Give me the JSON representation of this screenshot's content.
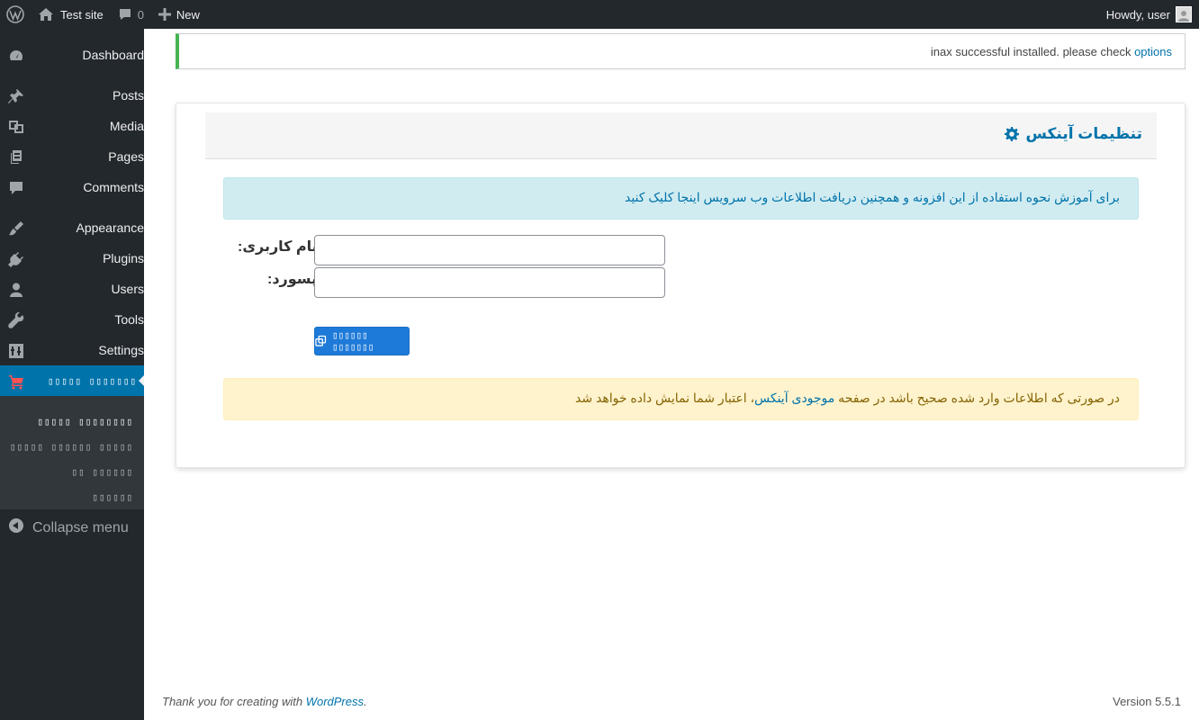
{
  "adminbar": {
    "site_name": "Test site",
    "comments_count": "0",
    "new_label": "New",
    "howdy": "Howdy, user"
  },
  "sidebar": {
    "items": [
      {
        "label": "Dashboard",
        "icon": "dashboard-icon"
      },
      {
        "label": "Posts",
        "icon": "pin-icon"
      },
      {
        "label": "Media",
        "icon": "media-icon"
      },
      {
        "label": "Pages",
        "icon": "pages-icon"
      },
      {
        "label": "Comments",
        "icon": "comment-icon"
      },
      {
        "label": "Appearance",
        "icon": "brush-icon"
      },
      {
        "label": "Plugins",
        "icon": "plug-icon"
      },
      {
        "label": "Users",
        "icon": "user-icon"
      },
      {
        "label": "Tools",
        "icon": "wrench-icon"
      },
      {
        "label": "Settings",
        "icon": "settings-icon"
      },
      {
        "label": "▯▯▯▯▯ ▯▯▯▯▯▯▯",
        "icon": "cart-icon"
      }
    ],
    "submenu": [
      "▯▯▯▯▯ ▯▯▯▯▯▯▯▯",
      "▯▯▯▯▯ ▯▯▯▯▯▯ ▯▯▯▯▯",
      "▯▯ ▯▯▯▯▯▯",
      "▯▯▯▯▯▯"
    ],
    "collapse_label": "Collapse menu"
  },
  "notice": {
    "text": "inax successful installed. please check ",
    "link": "options"
  },
  "card": {
    "title": "تنظیمات آینکس",
    "info_text": "برای آموزش نحوه استفاده از این افزونه و همچنین دریافت اطلاعات وب سرویس اینجا کلیک کنید",
    "username_label": "نام کاربری:",
    "password_label": "پسورد:",
    "username_value": "",
    "password_value": "",
    "submit_label": "▯▯▯▯▯▯ ▯▯▯▯▯▯▯",
    "warn_before": "در صورتی که اطلاعات وارد شده صحیح باشد در صفحه ",
    "warn_link": "موجودی آینکس",
    "warn_after": "، اعتبار شما نمایش داده خواهد شد"
  },
  "footer": {
    "thanks": "Thank you for creating with ",
    "wp_link": "WordPress",
    "thanks_end": ".",
    "version": "Version 5.5.1"
  },
  "colors": {
    "adminbar_bg": "#23282d",
    "accent": "#0073aa",
    "notice_success": "#46b450",
    "button": "#1e7ad8"
  }
}
